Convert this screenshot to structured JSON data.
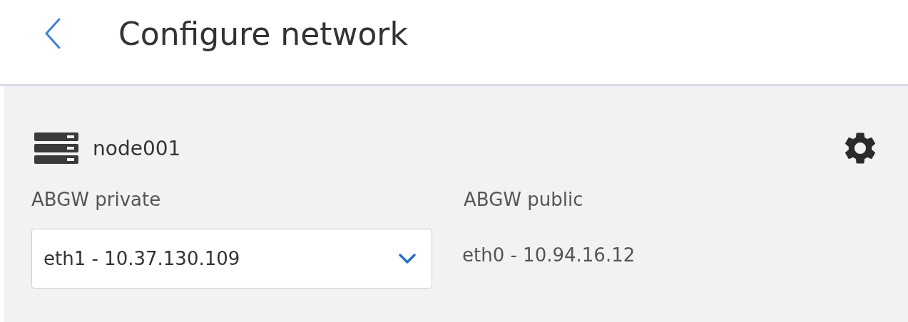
{
  "header": {
    "title": "Configure network"
  },
  "node": {
    "name": "node001"
  },
  "fields": [
    {
      "kind": "select",
      "label": "ABGW private",
      "value": "eth1 - 10.37.130.109"
    },
    {
      "kind": "text",
      "label": "ABGW public",
      "value": "eth0 - 10.94.16.12"
    }
  ]
}
